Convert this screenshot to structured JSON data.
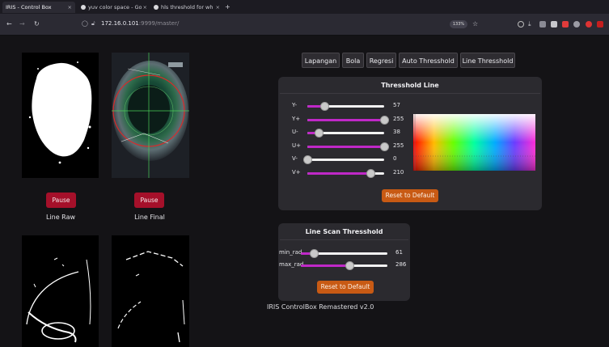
{
  "browser": {
    "tabs": [
      {
        "title": "IRIS - Control Box"
      },
      {
        "title": "yuv color space - Go"
      },
      {
        "title": "hls threshold for wh"
      }
    ],
    "new_tab_label": "+",
    "url_host": "172.16.0.101",
    "url_path": ":9999/master/",
    "zoom": "133%"
  },
  "feeds": [
    {
      "pause_label": "Pause",
      "caption": "Line Raw"
    },
    {
      "pause_label": "Pause",
      "caption": "Line Final"
    }
  ],
  "nav_tabs": [
    "Lapangan",
    "Bola",
    "Regresi",
    "Auto Thresshold",
    "Line Thresshold"
  ],
  "threshold_line": {
    "title": "Thresshold Line",
    "sliders": [
      {
        "label": "Y-",
        "value": "57",
        "fraction": 0.22
      },
      {
        "label": "Y+",
        "value": "255",
        "fraction": 1.0
      },
      {
        "label": "U-",
        "value": "38",
        "fraction": 0.15
      },
      {
        "label": "U+",
        "value": "255",
        "fraction": 1.0
      },
      {
        "label": "V-",
        "value": "0",
        "fraction": 0.0
      },
      {
        "label": "V+",
        "value": "210",
        "fraction": 0.82
      }
    ],
    "reset_label": "Reset to Default"
  },
  "line_scan": {
    "title": "Line Scan Thresshold",
    "sliders": [
      {
        "label": "min_rad",
        "value": "61",
        "fraction": 0.15
      },
      {
        "label": "max_rad",
        "value": "286",
        "fraction": 0.56
      }
    ],
    "reset_label": "Reset to Default"
  },
  "footer": "IRIS ControlBox Remastered v2.0",
  "colors": {
    "pause": "#a5102a",
    "reset": "#c85a14",
    "slider_fill": "#c028c8",
    "panel": "#2b2a2f"
  }
}
